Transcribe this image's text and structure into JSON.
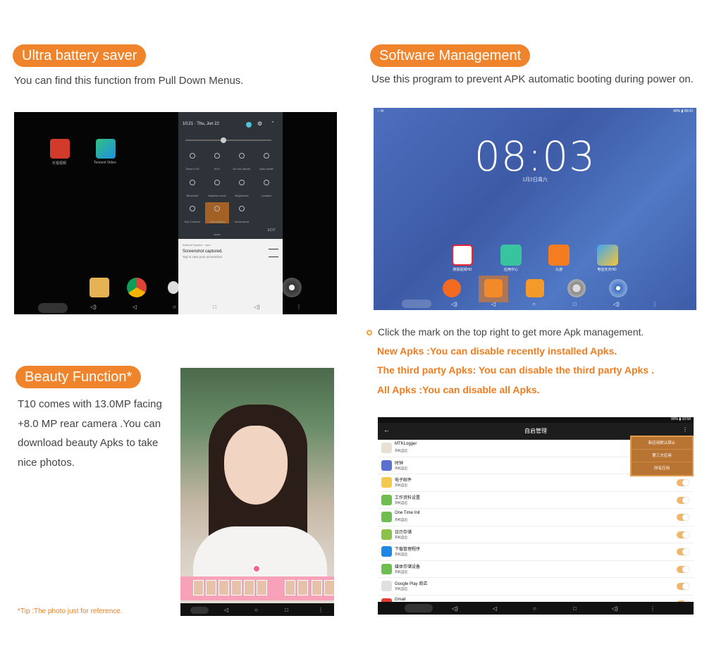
{
  "sections": {
    "battery": {
      "title": "Ultra battery saver",
      "desc": "You can find this function from Pull Down Menus."
    },
    "software": {
      "title": "Software Management",
      "desc": "Use this program to prevent APK automatic booting during power on.",
      "bullet": "Click the mark on the top right to get more Apk management.",
      "lines": [
        "New Apks :You can disable recently installed Apks.",
        "The third party Apks: You can disable the third party Apks .",
        "All Apks :You can disable all Apks."
      ]
    },
    "beauty": {
      "title": "Beauty Function*",
      "desc": "T10 comes with 13.0MP facing +8.0 MP rear camera .You can download beauty Apks to take nice photos.",
      "tip": "*Tip :The photo just for reference."
    }
  },
  "pulldown": {
    "time": "10:21 · Thu, Jun 22",
    "apps": [
      "乐视视频",
      "Tencent Video"
    ],
    "tiles": [
      "Team 5 4G",
      "51%",
      "Do not disturb",
      "Auto-rotate",
      "Bluetooth",
      "Airplane mode",
      "Brightness",
      "Location",
      "Eye Comfort",
      "Ultra battery saver",
      "Screenshot"
    ],
    "edit": "EDIT",
    "notif_source": "Android System · now ·",
    "notif_title": "Screenshot captured.",
    "notif_sub": "Tap to view your screenshot."
  },
  "homescreen": {
    "status_left": "♂ ✉",
    "status_right": "40% ▮ 08:03",
    "clock": "08:03",
    "date": "1月2日周六",
    "apps": [
      "搜狐视频HD",
      "应用中心",
      "九游",
      "电信天天HD"
    ]
  },
  "listscreen": {
    "status": "90% ▮ 10:58",
    "title": "自启管理",
    "menu": [
      "新应用默认禁止",
      "第三方应用",
      "所有应用"
    ],
    "rows": [
      {
        "name": "MTKLogger",
        "sub": "开机自启",
        "color": "#e8e0d0"
      },
      {
        "name": "时钟",
        "sub": "开机自启",
        "color": "#5a6fd0"
      },
      {
        "name": "电子邮件",
        "sub": "开机自启",
        "color": "#f2c94c"
      },
      {
        "name": "工作资料设置",
        "sub": "开机自启",
        "color": "#6cbf4e"
      },
      {
        "name": "One Time Init",
        "sub": "开机自启",
        "color": "#6cbf4e"
      },
      {
        "name": "日历存储",
        "sub": "开机自启",
        "color": "#8bc34a"
      },
      {
        "name": "下载管理程序",
        "sub": "开机自启",
        "color": "#1e88e5"
      },
      {
        "name": "媒体存储设备",
        "sub": "开机自启",
        "color": "#6cbf4e"
      },
      {
        "name": "Google Play 商店",
        "sub": "开机自启",
        "color": "#e0e0e0"
      },
      {
        "name": "Gmail",
        "sub": "",
        "color": "#e53935"
      }
    ]
  }
}
